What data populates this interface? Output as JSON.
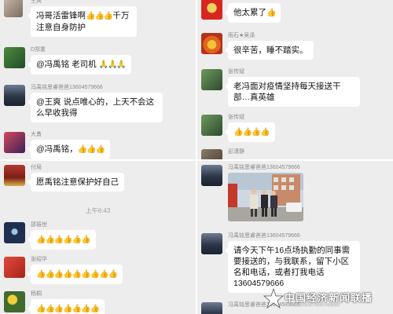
{
  "thumb": "👍👍👍",
  "panels": {
    "top_left": {
      "messages": [
        {
          "sender": "王爽",
          "text": "冯哥活雷锋啊",
          "emoji": "👍👍👍",
          "text2": "千万注意自身防护"
        },
        {
          "sender": "D郑重",
          "text": "@冯禹铭 老司机",
          "emoji": "🙏🙏🙏"
        },
        {
          "sender": "冯禹铭思睿爸爸13604579666",
          "text": "@王爽 说点唯心的，上天不会这么早收我得"
        },
        {
          "sender": "大勇",
          "text": "@冯禹铭，",
          "emoji": "👍👍👍"
        }
      ]
    },
    "top_right": {
      "messages": [
        {
          "sender": "",
          "text": "他太累了",
          "emoji": "👍"
        },
        {
          "sender": "雨石★吴涤",
          "text": "很辛苦，睡不踏实。"
        },
        {
          "sender": "张传斌",
          "text": "老冯面对疫情坚持每天接送干部…真英雄"
        },
        {
          "sender": "张传斌",
          "emoji": "👍👍👍👍"
        },
        {
          "sender": "彭潇静",
          "emoji": ""
        }
      ]
    },
    "bottom_left": {
      "messages": [
        {
          "sender": "付局",
          "text": "愿禹铭注意保护好自己"
        },
        {
          "sender": "邵振世",
          "emoji": "👍👍👍👍👍👍"
        },
        {
          "sender": "张绍华",
          "emoji": "👍👍👍👍👍👍👍👍👍"
        },
        {
          "sender": "杨桐",
          "emoji": "👍👍👍👍👍👍👍"
        }
      ],
      "timestamp": "上午6:43"
    },
    "bottom_right": {
      "messages": [
        {
          "sender": "冯禹铭思睿爸爸13604579666"
        },
        {
          "sender": "冯禹铭思睿爸爸13604579666",
          "text": "请今天下午16点场执勤的同事需要接送的，与我联系，留下小区名和电话，或者打我电话13604579666"
        },
        {
          "sender": "冯禹铭思睿爸爸13604579666"
        }
      ]
    }
  },
  "watermark": {
    "title": "中国经济新闻联播",
    "subtitle": "China Economic News Network"
  },
  "colors": {
    "panel_bg": "#ededed",
    "bubble": "#ffffff",
    "link": "#576b95",
    "emoji": "#e8a41a"
  }
}
